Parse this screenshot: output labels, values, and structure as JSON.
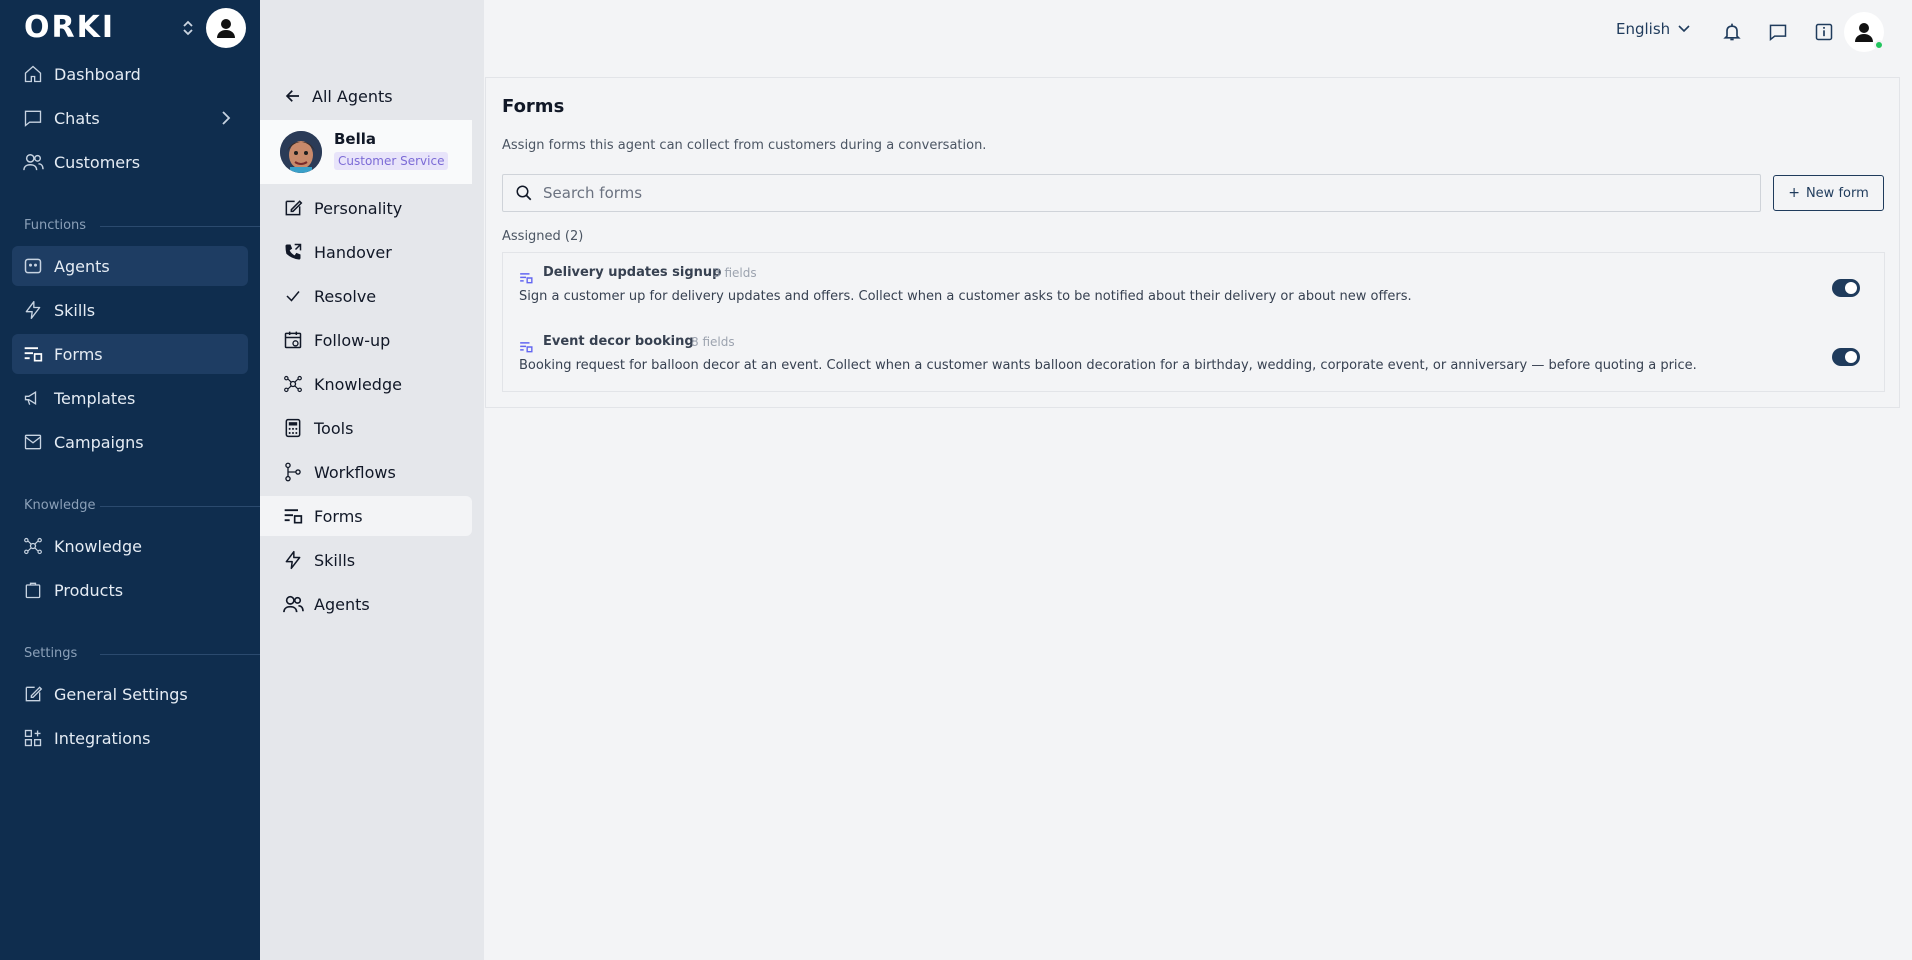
{
  "brand": {
    "name": "ORKI"
  },
  "sidebar": {
    "items": [
      {
        "label": "Dashboard",
        "icon": "home-icon"
      },
      {
        "label": "Chats",
        "icon": "chat-icon"
      },
      {
        "label": "Customers",
        "icon": "users-icon"
      }
    ],
    "functions_label": "Functions",
    "functions": [
      {
        "label": "Agents",
        "icon": "agent-icon",
        "active": true
      },
      {
        "label": "Skills",
        "icon": "bolt-icon"
      },
      {
        "label": "Forms",
        "icon": "form-icon",
        "active": true
      },
      {
        "label": "Templates",
        "icon": "megaphone-icon"
      },
      {
        "label": "Campaigns",
        "icon": "campaign-icon"
      }
    ],
    "knowledge_label": "Knowledge",
    "knowledge": [
      {
        "label": "Knowledge",
        "icon": "knowledge-icon"
      },
      {
        "label": "Products",
        "icon": "bag-icon"
      }
    ],
    "settings_label": "Settings",
    "settings": [
      {
        "label": "General Settings",
        "icon": "edit-icon"
      },
      {
        "label": "Integrations",
        "icon": "grid-icon"
      }
    ]
  },
  "agent_nav": {
    "back_label": "All Agents",
    "agent": {
      "name": "Bella",
      "role": "Customer Service"
    },
    "items": [
      {
        "label": "Personality",
        "icon": "edit-icon"
      },
      {
        "label": "Handover",
        "icon": "phone-icon"
      },
      {
        "label": "Resolve",
        "icon": "check-icon"
      },
      {
        "label": "Follow-up",
        "icon": "calendar-icon"
      },
      {
        "label": "Knowledge",
        "icon": "knowledge-icon"
      },
      {
        "label": "Tools",
        "icon": "calculator-icon"
      },
      {
        "label": "Workflows",
        "icon": "workflow-icon"
      },
      {
        "label": "Forms",
        "icon": "form-icon",
        "active": true
      },
      {
        "label": "Skills",
        "icon": "bolt-icon"
      },
      {
        "label": "Agents",
        "icon": "users-icon"
      }
    ]
  },
  "topbar": {
    "language": "English"
  },
  "main": {
    "title": "Forms",
    "description": "Assign forms this agent can collect from customers during a conversation.",
    "search_placeholder": "Search forms",
    "new_button": "New form",
    "assigned_label": "Assigned (2)",
    "forms": [
      {
        "name": "Delivery updates signup",
        "fields": "3 fields",
        "description": "Sign a customer up for delivery updates and offers. Collect when a customer asks to be notified about their delivery or about new offers.",
        "enabled": true
      },
      {
        "name": "Event decor booking",
        "fields": "8 fields",
        "description": "Booking request for balloon decor at an event. Collect when a customer wants balloon decoration for a birthday, wedding, corporate event, or anniversary — before quoting a price.",
        "enabled": true
      }
    ]
  },
  "colors": {
    "sidebar": "#0f2d4e",
    "accent": "#1f3b5c",
    "online": "#22c55e",
    "badge": "#7c6bd6"
  }
}
